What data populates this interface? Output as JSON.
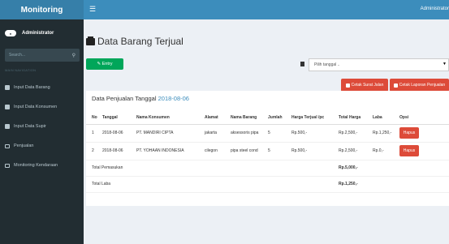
{
  "app": {
    "title": "Monitoring",
    "top_user": "Administrator"
  },
  "user": {
    "name": "Administrator"
  },
  "search": {
    "placeholder": "Search..."
  },
  "nav_header": "MAIN NAVIGATION",
  "nav": [
    {
      "label": "Input Data Barang"
    },
    {
      "label": "Input Data Konsumen"
    },
    {
      "label": "Input Data Supir"
    },
    {
      "label": "Penjualan"
    },
    {
      "label": "Monitoring Kendaraan"
    }
  ],
  "page": {
    "title": "Data Barang Terjual",
    "entry_label": "Entry",
    "date_placeholder": "Pilih tanggal ..",
    "cetak_surat_label": "Cetak Surat Jalan",
    "cetak_laporan_label": "Cetak Laporan Penjualan"
  },
  "panel": {
    "title_prefix": "Data Penjualan Tanggal",
    "date": "2018-08-06"
  },
  "table": {
    "headers": [
      "No",
      "Tanggal",
      "Nama Konsumen",
      "Alamat",
      "Nama Barang",
      "Jumlah",
      "Harga Terjual /pc",
      "Total Harga",
      "Laba",
      "Opsi"
    ],
    "rows": [
      {
        "no": "1",
        "tanggal": "2018-08-06",
        "konsumen": "PT. MANDIRI CIPTA",
        "alamat": "jakarta",
        "barang": "aksessoris pipa",
        "jumlah": "5",
        "harga": "Rp.500,-",
        "total": "Rp.2,500,-",
        "laba": "Rp.1,250,-",
        "opsi": "Hapus"
      },
      {
        "no": "2",
        "tanggal": "2018-08-06",
        "konsumen": "PT. YOHAAN INDONESIA",
        "alamat": "cilegon",
        "barang": "pipa steel cond",
        "jumlah": "5",
        "harga": "Rp.500,-",
        "total": "Rp.2,500,-",
        "laba": "Rp.0,-",
        "opsi": "Hapus"
      }
    ],
    "total_pemasukan_label": "Total Pemasukan",
    "total_pemasukan": "Rp.5,000,-",
    "total_laba_label": "Total Laba",
    "total_laba": "Rp.1,250,-"
  },
  "colors": {
    "header_blue": "#3c8dbc",
    "sidebar_dark": "#222d32",
    "green": "#00a65a",
    "red": "#dd4b39"
  }
}
